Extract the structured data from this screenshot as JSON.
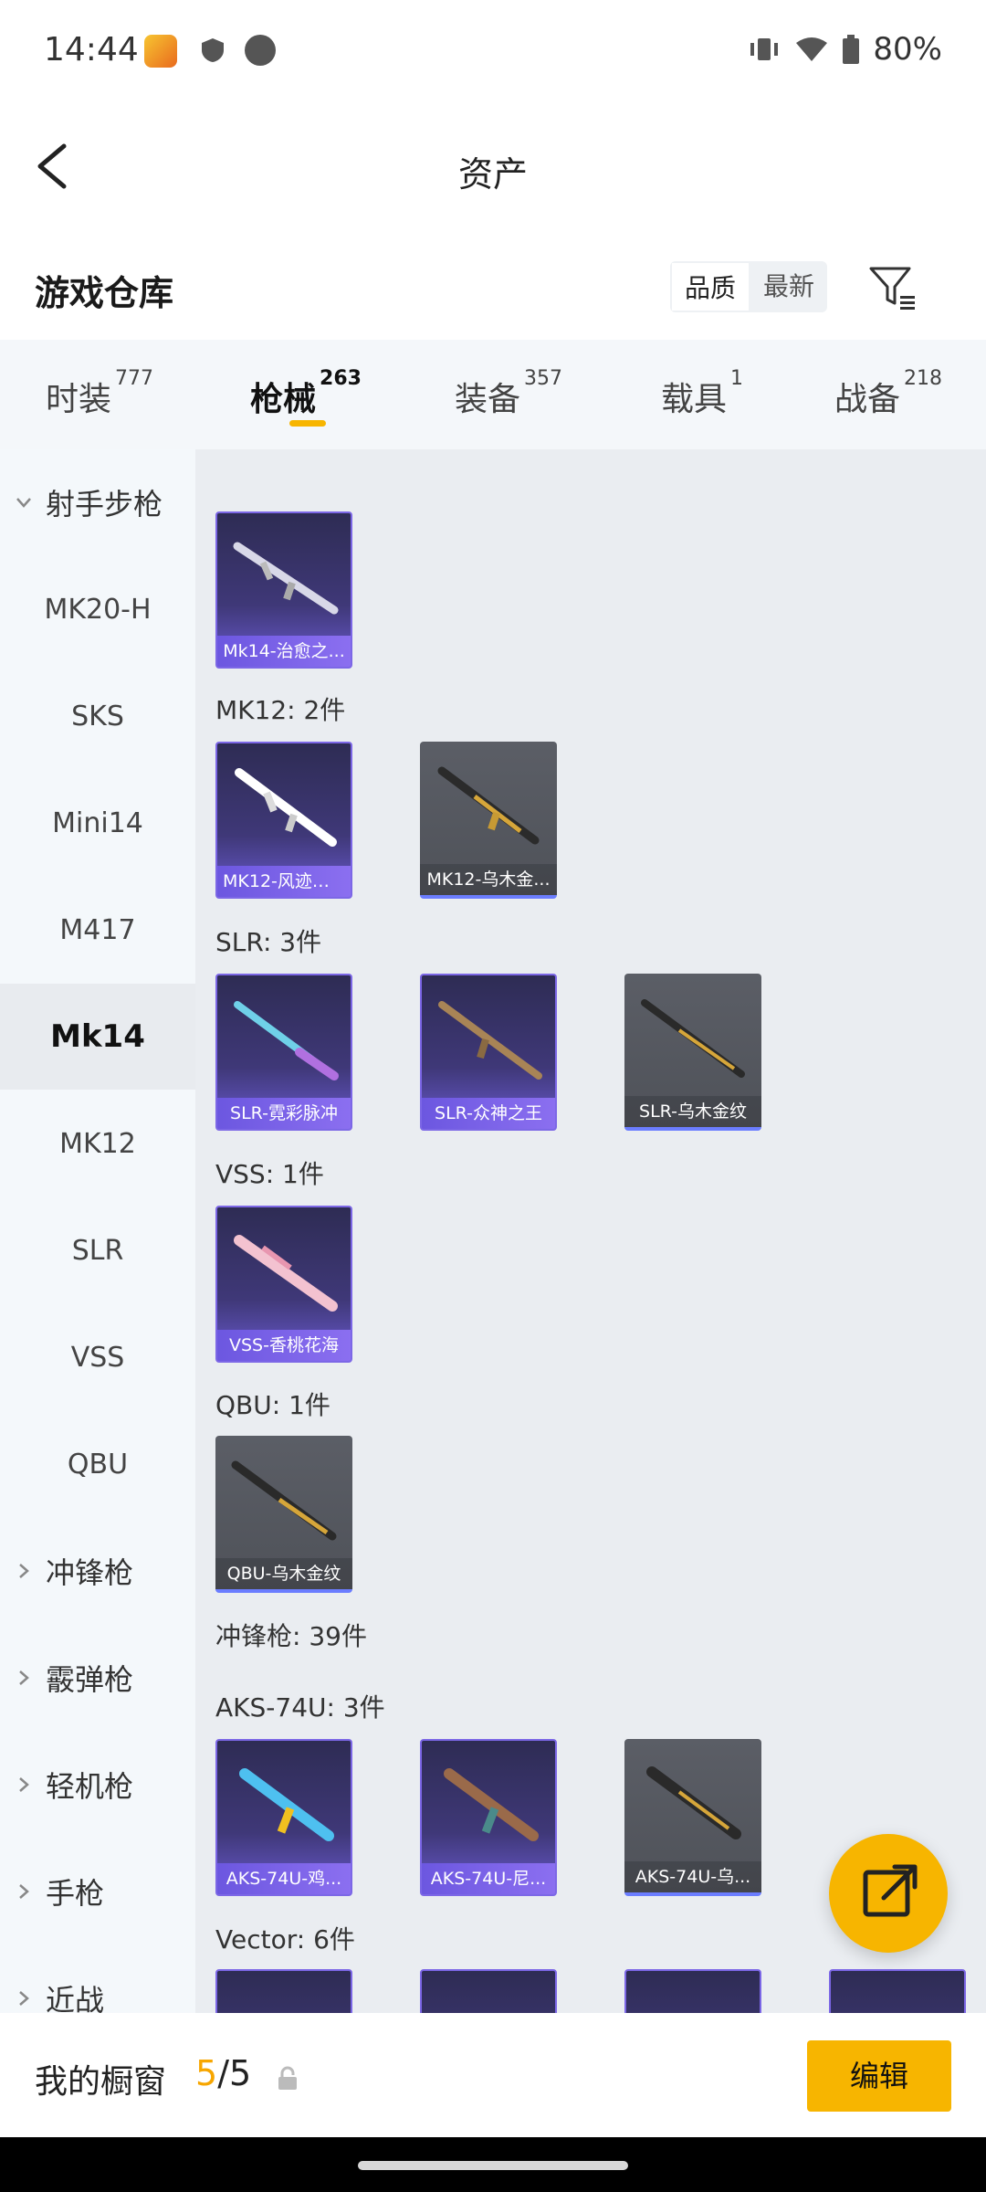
{
  "status_bar": {
    "time": "14:44",
    "battery": "80%"
  },
  "header": {
    "title": "资产"
  },
  "subheader": {
    "title": "游戏仓库",
    "sort_quality": "品质",
    "sort_latest": "最新"
  },
  "tabs": [
    {
      "label": "时装",
      "count": "777"
    },
    {
      "label": "枪械",
      "count": "263"
    },
    {
      "label": "装备",
      "count": "357"
    },
    {
      "label": "载具",
      "count": "1"
    },
    {
      "label": "战备",
      "count": "218"
    }
  ],
  "sidebar": {
    "groups": [
      {
        "label": "射手步枪"
      },
      {
        "label": "冲锋枪"
      },
      {
        "label": "霰弹枪"
      },
      {
        "label": "轻机枪"
      },
      {
        "label": "手枪"
      },
      {
        "label": "近战"
      }
    ],
    "items": [
      {
        "label": "MK20-H"
      },
      {
        "label": "SKS"
      },
      {
        "label": "Mini14"
      },
      {
        "label": "M417"
      },
      {
        "label": "Mk14"
      },
      {
        "label": "MK12"
      },
      {
        "label": "SLR"
      },
      {
        "label": "VSS"
      },
      {
        "label": "QBU"
      }
    ]
  },
  "content": {
    "groups": [
      {
        "label": "MK12: 2件"
      },
      {
        "label": "SLR: 3件"
      },
      {
        "label": "VSS: 1件"
      },
      {
        "label": "QBU: 1件"
      },
      {
        "label": "冲锋枪: 39件"
      },
      {
        "label": "AKS-74U: 3件"
      },
      {
        "label": "Vector: 6件"
      }
    ],
    "cards": [
      {
        "caption": "Mk14-治愈之..."
      },
      {
        "caption": "MK12-风迹短..."
      },
      {
        "caption": "MK12-乌木金..."
      },
      {
        "caption": "SLR-霓彩脉冲"
      },
      {
        "caption": "SLR-众神之王"
      },
      {
        "caption": "SLR-乌木金纹"
      },
      {
        "caption": "VSS-香桃花海"
      },
      {
        "caption": "QBU-乌木金纹"
      },
      {
        "caption": "AKS-74U-鸡..."
      },
      {
        "caption": "AKS-74U-尼..."
      },
      {
        "caption": "AKS-74U-乌..."
      }
    ]
  },
  "footer": {
    "label": "我的橱窗",
    "current": "5",
    "total": "/5",
    "edit": "编辑"
  },
  "colors": {
    "accent": "#f7b500",
    "purple": "#7c67e6"
  }
}
